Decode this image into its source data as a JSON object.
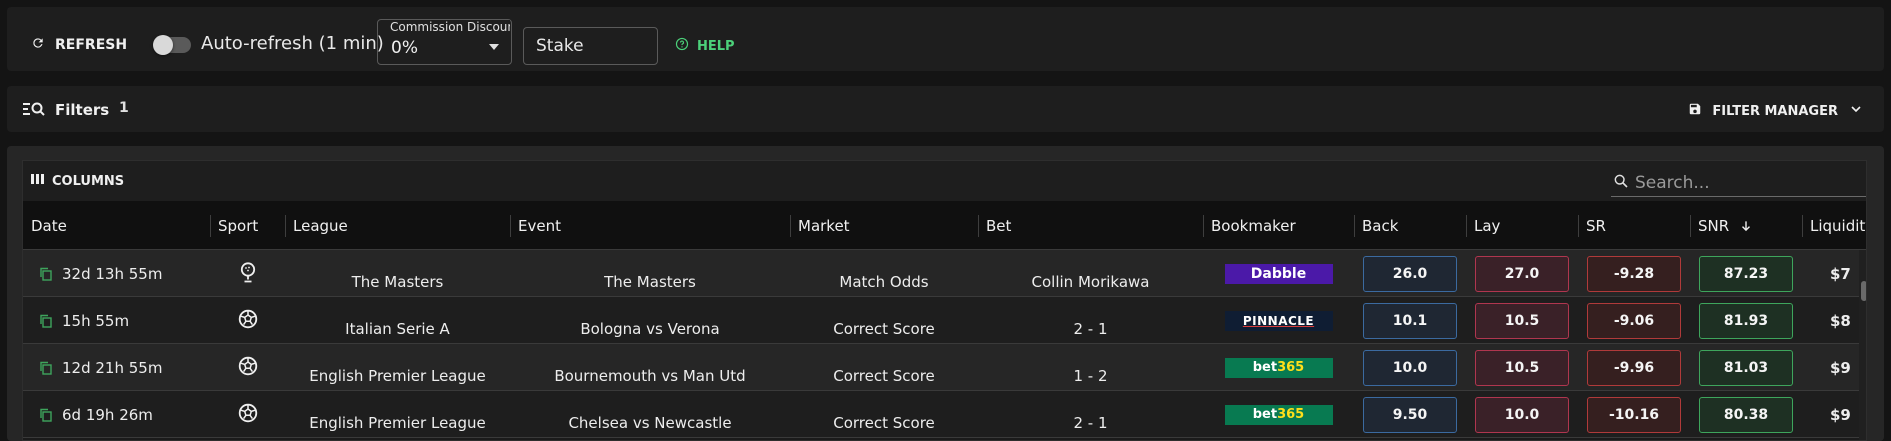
{
  "toolbar": {
    "refresh_label": "REFRESH",
    "auto_refresh_label": "Auto-refresh (1 min)",
    "auto_refresh_on": false,
    "commission_label": "Commission Discount",
    "commission_value": "0%",
    "stake_placeholder": "Stake",
    "help_label": "HELP"
  },
  "filters": {
    "label": "Filters",
    "count": "1",
    "filter_manager_label": "FILTER MANAGER"
  },
  "grid": {
    "columns_label": "COLUMNS",
    "search_placeholder": "Search...",
    "headers": {
      "date": "Date",
      "sport": "Sport",
      "league": "League",
      "event": "Event",
      "market": "Market",
      "bet": "Bet",
      "bookmaker": "Bookmaker",
      "back": "Back",
      "lay": "Lay",
      "sr": "SR",
      "snr": "SNR",
      "liquidity": "Liquidity"
    },
    "sort_column": "SNR",
    "sort_direction": "descending",
    "rows": [
      {
        "date": "32d 13h 55m",
        "sport_icon": "golf-icon",
        "league": "The Masters",
        "event": "The Masters",
        "market": "Match Odds",
        "bet": "Collin Morikawa",
        "bookmaker": "Dabble",
        "back": "26.0",
        "lay": "27.0",
        "sr": "-9.28",
        "snr": "87.23",
        "liquidity": "$7"
      },
      {
        "date": "15h 55m",
        "sport_icon": "soccer-icon",
        "league": "Italian Serie A",
        "event": "Bologna vs Verona",
        "market": "Correct Score",
        "bet": "2 - 1",
        "bookmaker": "PINNACLE",
        "back": "10.1",
        "lay": "10.5",
        "sr": "-9.06",
        "snr": "81.93",
        "liquidity": "$8"
      },
      {
        "date": "12d 21h 55m",
        "sport_icon": "soccer-icon",
        "league": "English Premier League",
        "event": "Bournemouth vs Man Utd",
        "market": "Correct Score",
        "bet": "1 - 2",
        "bookmaker": "bet365",
        "back": "10.0",
        "lay": "10.5",
        "sr": "-9.96",
        "snr": "81.03",
        "liquidity": "$9"
      },
      {
        "date": "6d 19h 26m",
        "sport_icon": "soccer-icon",
        "league": "English Premier League",
        "event": "Chelsea vs Newcastle",
        "market": "Correct Score",
        "bet": "2 - 1",
        "bookmaker": "bet365",
        "back": "9.50",
        "lay": "10.0",
        "sr": "-10.16",
        "snr": "80.38",
        "liquidity": "$9"
      }
    ]
  },
  "colors": {
    "accent_green": "#4cd17a",
    "back_border": "#3b6aa0",
    "lay_border": "#b0364f",
    "sr_border": "#b03a3a",
    "snr_border": "#3ea55c",
    "dabble": "#4b19a8",
    "pinnacle": "#0f1d33",
    "bet365": "#087a51"
  }
}
